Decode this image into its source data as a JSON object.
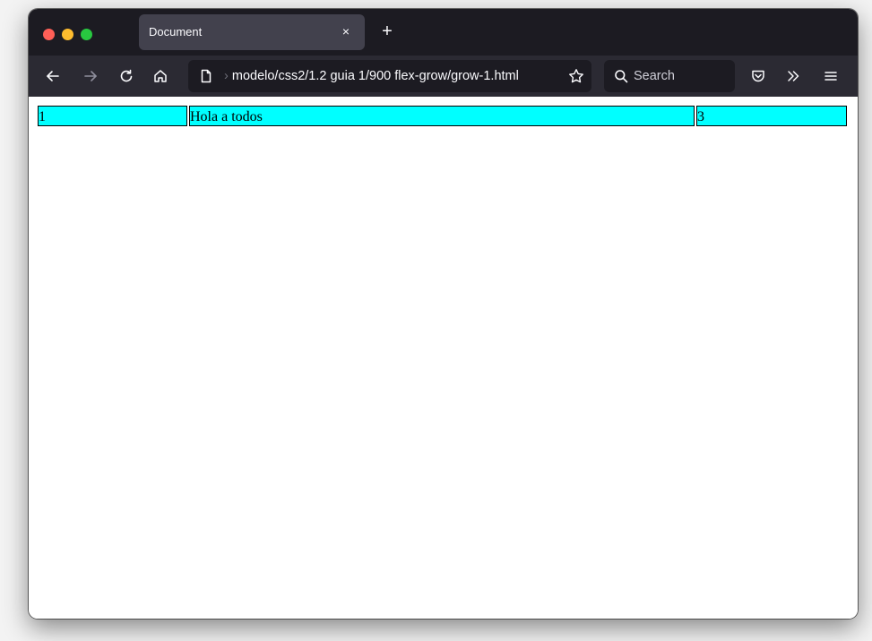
{
  "browser": {
    "tab": {
      "title": "Document",
      "close_glyph": "×"
    },
    "new_tab_glyph": "+",
    "toolbar": {
      "icons": [
        "back-arrow-icon",
        "forward-arrow-icon",
        "reload-icon",
        "home-icon",
        "page-icon",
        "bookmark-star-icon",
        "search-icon",
        "pocket-icon",
        "overflow-chevrons-icon",
        "menu-icon"
      ]
    },
    "urlbar": {
      "url_prefix": "›",
      "url": "modelo/css2/1.2 guia 1/900 flex-grow/grow-1.html"
    },
    "searchbar": {
      "placeholder": "Search"
    }
  },
  "page": {
    "items": [
      {
        "label": "1"
      },
      {
        "label": "Hola a todos"
      },
      {
        "label": "3"
      }
    ]
  },
  "colors": {
    "tabbar": "#1c1b22",
    "toolbar": "#2b2a33",
    "active_tab": "#42414d",
    "flex_item_bg": "#00ffff"
  }
}
